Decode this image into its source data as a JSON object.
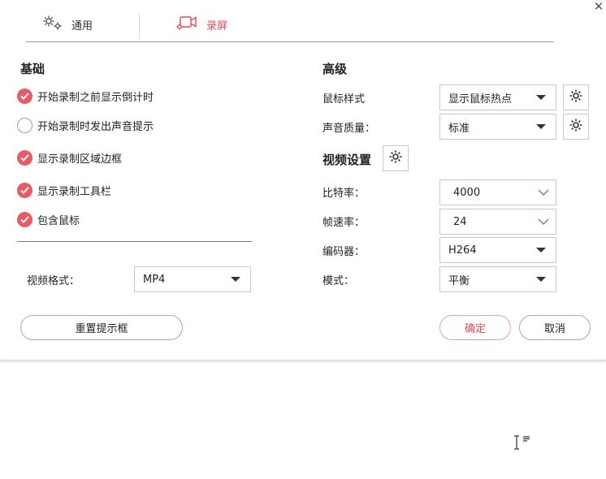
{
  "tabs": [
    {
      "label": "通用",
      "icon": "gears-icon",
      "active": false
    },
    {
      "label": "录屏",
      "icon": "video-camera-icon",
      "active": true
    }
  ],
  "close_icon": "close-icon",
  "basic": {
    "title": "基础",
    "options": [
      {
        "label": "开始录制之前显示倒计时",
        "checked": true
      },
      {
        "label": "开始录制时发出声音提示",
        "checked": false
      },
      {
        "label": "显示录制区域边框",
        "checked": true
      },
      {
        "label": "显示录制工具栏",
        "checked": true
      },
      {
        "label": "包含鼠标",
        "checked": true
      }
    ],
    "format_label": "视频格式：",
    "format_value": "MP4"
  },
  "advanced": {
    "title": "高级",
    "mouse_style_label": "鼠标样式",
    "mouse_style_value": "显示鼠标热点",
    "audio_quality_label": "声音质量：",
    "audio_quality_value": "标准",
    "video_settings_title": "视频设置",
    "bitrate_label": "比特率：",
    "bitrate_value": "4000",
    "framerate_label": "帧速率：",
    "framerate_value": "24",
    "encoder_label": "编码器：",
    "encoder_value": "H264",
    "mode_label": "模式：",
    "mode_value": "平衡"
  },
  "buttons": {
    "reset": "重置提示框",
    "ok": "确定",
    "cancel": "取消"
  },
  "colors": {
    "accent": "#e04a55",
    "check_on": "#e85b64"
  }
}
